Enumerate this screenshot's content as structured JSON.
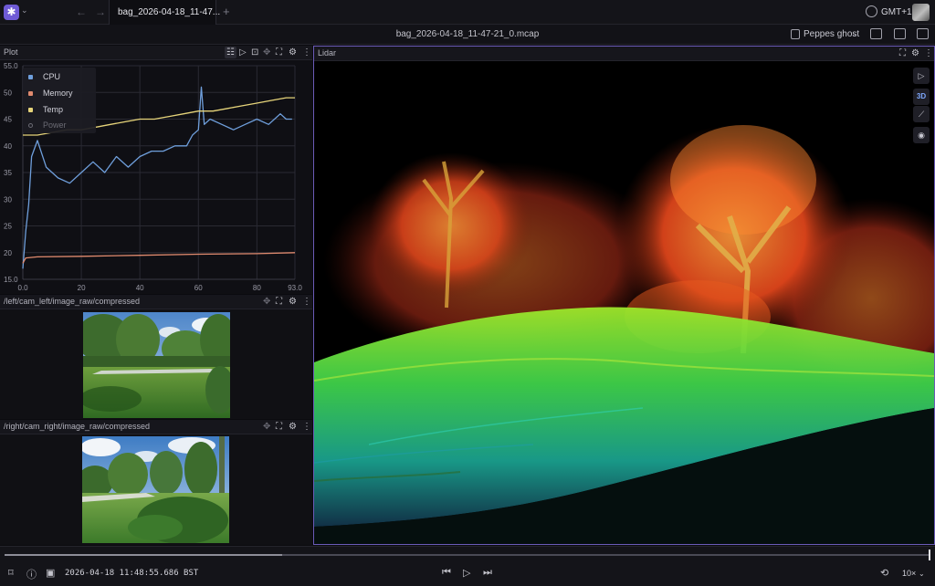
{
  "app": {
    "tab_label": "bag_2026-04-18_11-47...",
    "tab_add": "+",
    "timezone": "GMT+1"
  },
  "titlebar": {
    "file_name": "bag_2026-04-18_11-47-21_0.mcap",
    "layout_name": "Peppes ghost"
  },
  "plot": {
    "title": "Plot",
    "legend": [
      {
        "label": "CPU",
        "color": "#6f9fdc"
      },
      {
        "label": "Memory",
        "color": "#e08a6e"
      },
      {
        "label": "Temp",
        "color": "#e6d47a"
      },
      {
        "label": "Power",
        "color": "#6b6b74"
      }
    ],
    "chart_data": {
      "type": "line",
      "title": "",
      "xlabel": "",
      "ylabel": "",
      "xlim": [
        0,
        93
      ],
      "ylim": [
        15,
        55
      ],
      "x_ticks": [
        "0.0",
        "20",
        "40",
        "60",
        "80",
        "93.0"
      ],
      "y_ticks": [
        "55.0",
        "50",
        "45",
        "40",
        "35",
        "30",
        "25",
        "20",
        "15.0"
      ],
      "grid": true,
      "legend_position": "top-left",
      "series": [
        {
          "name": "CPU",
          "color": "#6f9fdc",
          "x": [
            0,
            1,
            2,
            3,
            5,
            8,
            12,
            16,
            20,
            24,
            28,
            32,
            36,
            40,
            44,
            48,
            52,
            56,
            58,
            60,
            61,
            62,
            64,
            68,
            72,
            76,
            80,
            84,
            88,
            90,
            92
          ],
          "y": [
            17,
            24,
            29,
            38,
            41,
            36,
            34,
            33,
            35,
            37,
            35,
            38,
            36,
            38,
            39,
            39,
            40,
            40,
            42,
            43,
            51,
            44,
            45,
            44,
            43,
            44,
            45,
            44,
            46,
            45,
            45
          ]
        },
        {
          "name": "Memory",
          "color": "#e08a6e",
          "x": [
            0,
            1,
            5,
            20,
            40,
            60,
            80,
            93
          ],
          "y": [
            18,
            19,
            19.2,
            19.3,
            19.5,
            19.7,
            19.8,
            20
          ]
        },
        {
          "name": "Temp",
          "color": "#e6d47a",
          "x": [
            0,
            5,
            10,
            15,
            20,
            25,
            30,
            35,
            40,
            45,
            50,
            55,
            60,
            65,
            70,
            75,
            80,
            85,
            90,
            93
          ],
          "y": [
            42,
            42,
            42.5,
            43,
            43,
            43.5,
            44,
            44.5,
            45,
            45,
            45.5,
            46,
            46.5,
            46.5,
            47,
            47.5,
            48,
            48.5,
            49,
            49
          ]
        },
        {
          "name": "Power",
          "color": "#6b6b74",
          "x": [],
          "y": []
        }
      ]
    }
  },
  "cam_left": {
    "title": "/left/cam_left/image_raw/compressed"
  },
  "cam_right": {
    "title": "/right/cam_right/image_raw/compressed"
  },
  "lidar": {
    "title": "Lidar",
    "mode_3d": "3D"
  },
  "playback": {
    "timestamp": "2026-04-18 11:48:55.686 BST",
    "progress": 0.3,
    "speed": "10×"
  }
}
